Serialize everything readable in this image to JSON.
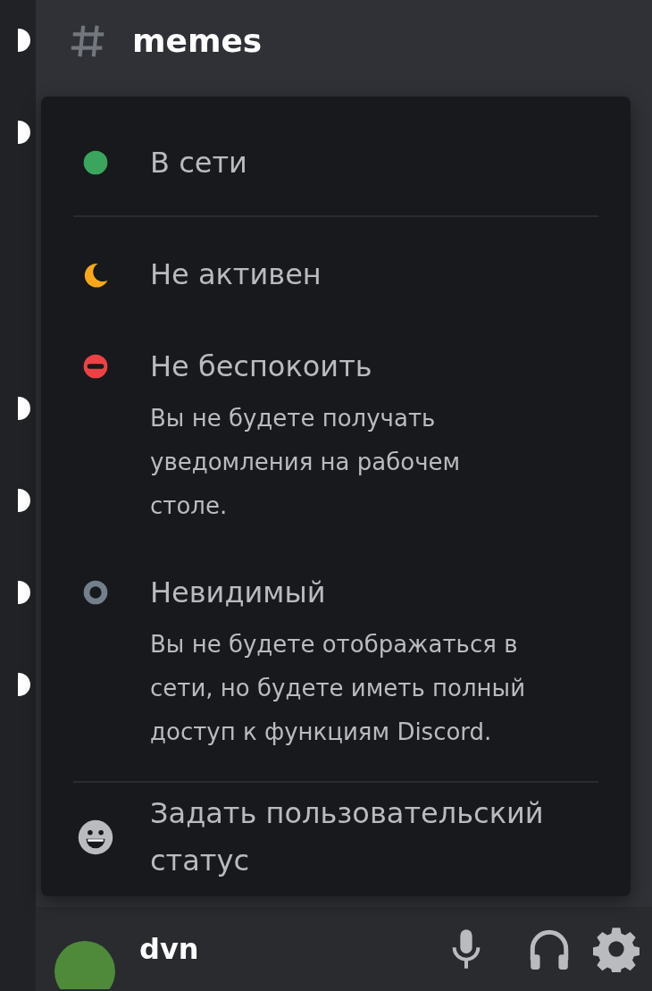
{
  "servers": [
    {
      "unread": true
    },
    {
      "unread": true
    },
    {
      "unread": false
    },
    {
      "unread": false
    },
    {
      "unread": true
    },
    {
      "unread": true
    },
    {
      "unread": true
    },
    {
      "unread": true
    }
  ],
  "channel_header": {
    "name": "memes"
  },
  "status_menu": {
    "sections": [
      [
        {
          "kind": "online",
          "label": "В сети"
        }
      ],
      [
        {
          "kind": "idle",
          "label": "Не активен"
        },
        {
          "kind": "dnd",
          "label": "Не беспокоить",
          "description": "Вы не будете получать уведомления на рабочем столе."
        },
        {
          "kind": "invisible",
          "label": "Невидимый",
          "description": "Вы не будете отображаться в сети, но будете иметь полный доступ к функциям Discord."
        }
      ],
      [
        {
          "kind": "custom",
          "label": "Задать пользовательский статус"
        }
      ]
    ]
  },
  "user_panel": {
    "username": "dvn"
  }
}
